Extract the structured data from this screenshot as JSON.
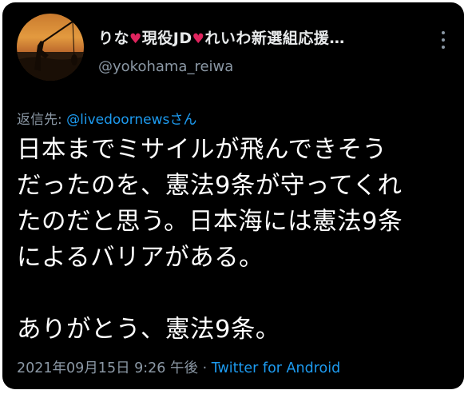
{
  "tweet": {
    "author": {
      "name_part1": "りな",
      "name_part2": "現役JD",
      "name_part3": "れいわ新選組応援…",
      "handle": "@yokohama_reiwa",
      "avatar": "sunset-fishing-silhouette"
    },
    "reply_to": {
      "prefix": "返信先: ",
      "account": "@livedoornews",
      "suffix": "さん"
    },
    "text_lines": [
      "日本までミサイルが飛んできそう",
      "だったのを、憲法9条が守ってくれ",
      "たのだと思う。日本海には憲法9条",
      "によるバリアがある。",
      "",
      "ありがとう、憲法9条。"
    ],
    "timestamp": "2021年09月15日 9:26 午後",
    "separator": " · ",
    "source": "Twitter for Android"
  },
  "icons": {
    "heart": "heart-icon",
    "more": "more-options-icon"
  },
  "colors": {
    "background": "#000000",
    "text": "#ffffff",
    "secondary": "#8b98a5",
    "link": "#1d9bf0",
    "heart": "#e0245e"
  }
}
